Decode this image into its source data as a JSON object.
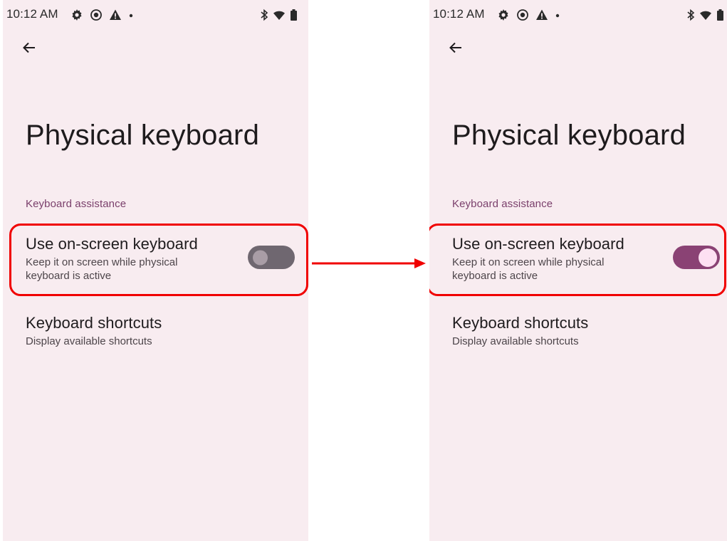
{
  "colors": {
    "screen_bg": "#f8ecf0",
    "accent": "#8a4274",
    "section_header": "#7a3f6b",
    "highlight": "#f00000",
    "toggle_off_track": "#6f6770",
    "toggle_on_thumb": "#fde0f2"
  },
  "screens": [
    {
      "status": {
        "time": "10:12 AM",
        "notification_icons": [
          "gear-icon",
          "record-icon",
          "warning-icon",
          "dot-icon"
        ],
        "system_icons": [
          "bluetooth-icon",
          "wifi-icon",
          "battery-icon"
        ]
      },
      "title": "Physical keyboard",
      "section_header": "Keyboard assistance",
      "items": [
        {
          "title": "Use on-screen keyboard",
          "summary": "Keep it on screen while physical keyboard is active",
          "toggle": "off"
        },
        {
          "title": "Keyboard shortcuts",
          "summary": "Display available shortcuts"
        }
      ]
    },
    {
      "status": {
        "time": "10:12 AM",
        "notification_icons": [
          "gear-icon",
          "record-icon",
          "warning-icon",
          "dot-icon"
        ],
        "system_icons": [
          "bluetooth-icon",
          "wifi-icon",
          "battery-icon"
        ]
      },
      "title": "Physical keyboard",
      "section_header": "Keyboard assistance",
      "items": [
        {
          "title": "Use on-screen keyboard",
          "summary": "Keep it on screen while physical keyboard is active",
          "toggle": "on"
        },
        {
          "title": "Keyboard shortcuts",
          "summary": "Display available shortcuts"
        }
      ]
    }
  ]
}
